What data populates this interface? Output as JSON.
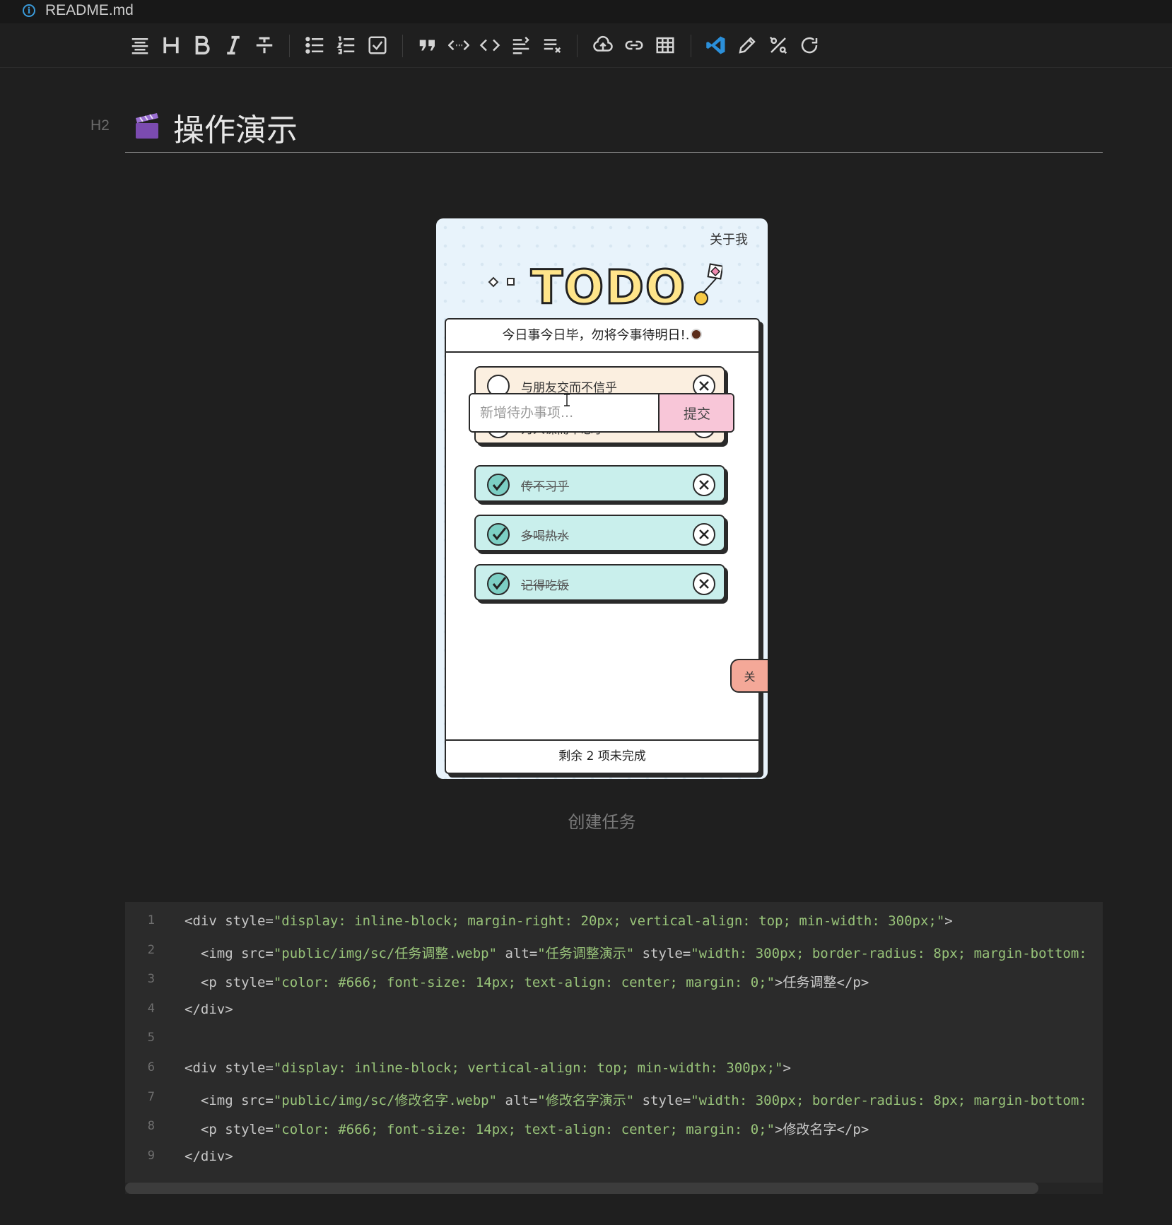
{
  "tab": {
    "file_name": "README.md"
  },
  "toolbar": {
    "buttons": [
      "headings",
      "heading",
      "bold",
      "italic",
      "strikethrough",
      "unordered-list",
      "ordered-list",
      "task-list",
      "quote",
      "inline-code",
      "code-block",
      "indent",
      "outdent",
      "upload",
      "link",
      "table",
      "vscode",
      "edit",
      "fullscreen",
      "refresh"
    ]
  },
  "heading": {
    "level": "H2",
    "title": "操作演示"
  },
  "demo": {
    "about": "关于我",
    "logo": "TODO",
    "motto": "今日事今日毕，勿将今事待明日!.",
    "items": [
      {
        "text": "与朋友交而不信乎",
        "done": false
      },
      {
        "text": "为人谋而不忠乎",
        "done": false
      },
      {
        "text": "传不习乎",
        "done": true
      },
      {
        "text": "多喝热水",
        "done": true
      },
      {
        "text": "记得吃饭",
        "done": true
      }
    ],
    "input_placeholder": "新增待办事项...",
    "submit": "提交",
    "close": "关",
    "footer": "剩余 2 项未完成"
  },
  "caption": "创建任务",
  "code": {
    "lines": [
      {
        "n": "1",
        "parts": [
          [
            "t",
            "<div style="
          ],
          [
            "v",
            "\"display: inline-block; margin-right: 20px; vertical-align: top; min-width: 300px;\""
          ],
          [
            "t",
            ">"
          ]
        ]
      },
      {
        "n": "2",
        "parts": [
          [
            "t",
            "  <img src="
          ],
          [
            "v",
            "\"public/img/sc/任务调整.webp\""
          ],
          [
            "t",
            " alt="
          ],
          [
            "v",
            "\"任务调整演示\""
          ],
          [
            "t",
            " style="
          ],
          [
            "v",
            "\"width: 300px; border-radius: 8px; margin-bottom:"
          ]
        ]
      },
      {
        "n": "3",
        "parts": [
          [
            "t",
            "  <p style="
          ],
          [
            "v",
            "\"color: #666; font-size: 14px; text-align: center; margin: 0;\""
          ],
          [
            "t",
            ">任务调整</p>"
          ]
        ]
      },
      {
        "n": "4",
        "parts": [
          [
            "t",
            "</div>"
          ]
        ]
      },
      {
        "n": "5",
        "parts": []
      },
      {
        "n": "6",
        "parts": [
          [
            "t",
            "<div style="
          ],
          [
            "v",
            "\"display: inline-block; vertical-align: top; min-width: 300px;\""
          ],
          [
            "t",
            ">"
          ]
        ]
      },
      {
        "n": "7",
        "parts": [
          [
            "t",
            "  <img src="
          ],
          [
            "v",
            "\"public/img/sc/修改名字.webp\""
          ],
          [
            "t",
            " alt="
          ],
          [
            "v",
            "\"修改名字演示\""
          ],
          [
            "t",
            " style="
          ],
          [
            "v",
            "\"width: 300px; border-radius: 8px; margin-bottom:"
          ]
        ]
      },
      {
        "n": "8",
        "parts": [
          [
            "t",
            "  <p style="
          ],
          [
            "v",
            "\"color: #666; font-size: 14px; text-align: center; margin: 0;\""
          ],
          [
            "t",
            ">修改名字</p>"
          ]
        ]
      },
      {
        "n": "9",
        "parts": [
          [
            "t",
            "</div>"
          ]
        ]
      }
    ]
  },
  "colors": {
    "background": "#1f1f1f",
    "code_bg": "#2b2b2b",
    "code_string": "#98c379",
    "todo_item": "#fbefe0",
    "done_item": "#c9efec",
    "submit": "#f8c6d8",
    "close": "#f4a898",
    "vscode_blue": "#2b8fd9"
  }
}
